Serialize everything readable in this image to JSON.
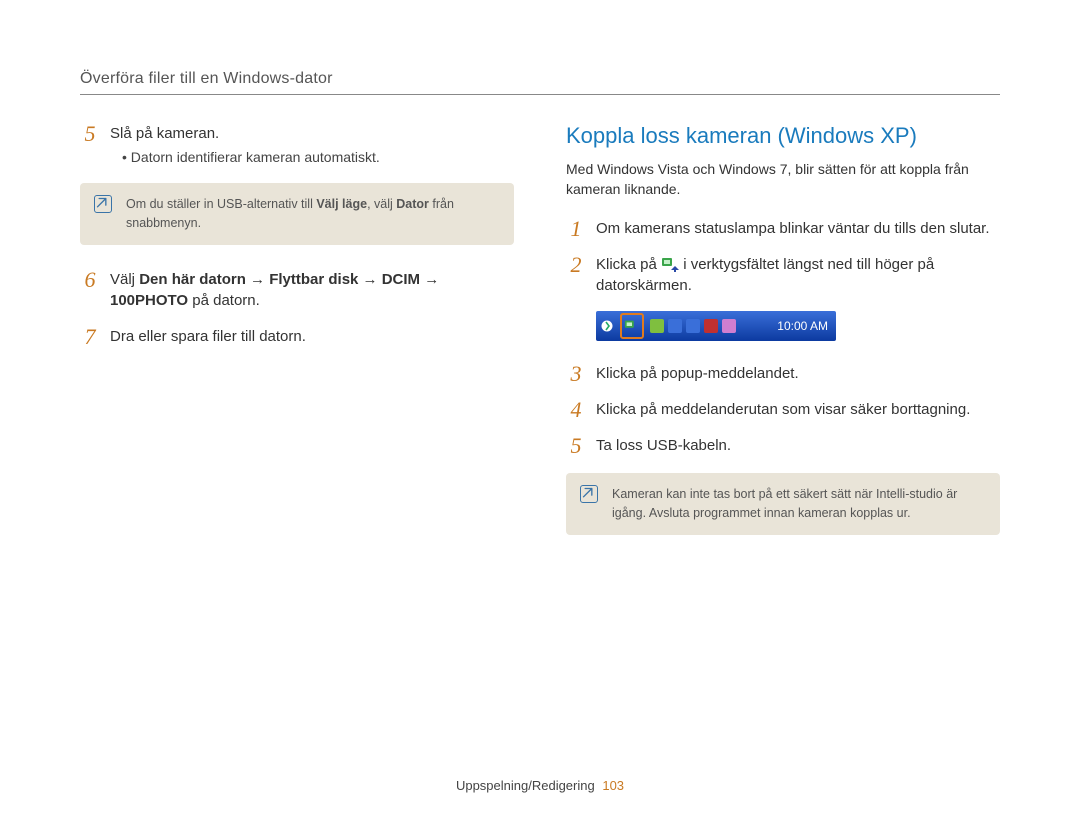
{
  "header": "Överföra filer till en Windows-dator",
  "left": {
    "step5": {
      "num": "5",
      "title": "Slå på kameran.",
      "bullet": "Datorn identifierar kameran automatiskt."
    },
    "note1": {
      "prefix": "Om du ställer in USB-alternativ till ",
      "bold1": "Välj läge",
      "mid": ", välj ",
      "bold2": "Dator",
      "suffix": " från snabbmenyn."
    },
    "step6": {
      "num": "6",
      "prefix": "Välj ",
      "bold": "Den här datorn → Flyttbar disk → DCIM → 100PHOTO",
      "suffix": " på datorn."
    },
    "step7": {
      "num": "7",
      "text": "Dra eller spara filer till datorn."
    }
  },
  "right": {
    "h2": "Koppla loss kameran (Windows XP)",
    "intro": "Med Windows Vista och Windows 7, blir sätten för att koppla från kameran liknande.",
    "step1": {
      "num": "1",
      "text": "Om kamerans statuslampa blinkar väntar du tills den slutar."
    },
    "step2": {
      "num": "2",
      "prefix": "Klicka på ",
      "suffix": " i verktygsfältet längst ned till höger på datorskärmen."
    },
    "taskbar_time": "10:00 AM",
    "step3": {
      "num": "3",
      "text": "Klicka på popup-meddelandet."
    },
    "step4": {
      "num": "4",
      "text": "Klicka på meddelanderutan som visar säker borttagning."
    },
    "step5": {
      "num": "5",
      "text": "Ta loss USB-kabeln."
    },
    "note2": "Kameran kan inte tas bort på ett säkert sätt när Intelli-studio är igång. Avsluta programmet innan kameran kopplas ur."
  },
  "footer": {
    "section": "Uppspelning/Redigering",
    "page": "103"
  }
}
